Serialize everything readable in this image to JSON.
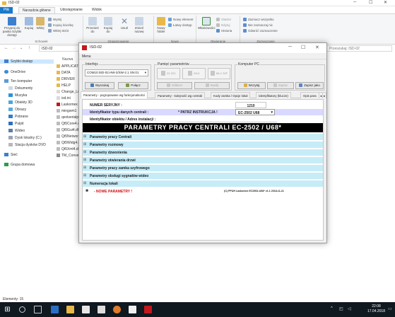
{
  "explorer": {
    "title": "ISD-02",
    "tabs": [
      "Plik",
      "Narzędzia główne",
      "Udostępnianie",
      "Widok"
    ],
    "ribbon": {
      "groups": [
        {
          "label": "Schowek",
          "buttons": [
            "Przypnij do paska Szybki dostęp",
            "Kopiuj",
            "Wklej"
          ],
          "small": [
            "Wytnij",
            "Kopiuj ścieżkę",
            "Wklej skrót"
          ]
        },
        {
          "label": "Organizowanie",
          "buttons": [
            "Przenieś do",
            "Kopiuj do",
            "Usuń",
            "Zmień nazwę"
          ]
        },
        {
          "label": "Nowy",
          "buttons": [
            "Nowy folder"
          ],
          "small": [
            "Nowy element",
            "Łatwy dostęp"
          ]
        },
        {
          "label": "Otwieranie",
          "buttons": [
            "Właściwości"
          ],
          "small": [
            "Otwórz",
            "Edytuj",
            "Historia"
          ]
        },
        {
          "label": "Zaznaczanie",
          "small": [
            "Zaznacz wszystko",
            "Nie zaznaczaj nic",
            "Odwróć zaznaczenie"
          ]
        }
      ]
    },
    "address": "ISD-02",
    "search_placeholder": "Przeszukaj: ISD-02",
    "nav": [
      "Szybki dostęp",
      "OneDrive",
      "Ten komputer",
      "Dokumenty",
      "Muzyka",
      "Obiekty 3D",
      "Obrazy",
      "Pobrane",
      "Pulpit",
      "Wideo",
      "Dysk lokalny (C:)",
      "Stacja dysków DVD",
      "Sieć",
      "Grupa domowa"
    ],
    "file_header": "Nazwa",
    "files": [
      "APPLICATI",
      "DATA",
      "DRIVER",
      "HELP",
      "Change_Lo",
      "isd.ini",
      "Laskomex",
      "mingwm1",
      "qextserialp",
      "Qt5Core4.dll",
      "Qt5Gui4.dll",
      "Qt5Network",
      "Qt5Widg4.dll",
      "Qt5Xml4.dll",
      "TM_Conve"
    ],
    "status": "Elementy: 15",
    "clock_time": "22:08",
    "clock_date": "17.04.2018"
  },
  "app": {
    "title": "ISD-02",
    "menu": "Menu",
    "interfejs_label": "Interfejs",
    "port_value": "COM10:ISD-02.HW-2/SW-2.1 SN:01",
    "btn_wyszukaj": "Wyszukaj",
    "btn_polacz": "Połącz",
    "pamiec_label": "Pamięć parametrów",
    "mem_buttons": [
      "22.22C",
      "MLX",
      "MLX 32F"
    ],
    "btn_odbierz": "Odbierz",
    "btn_wyslij": "Wyślij",
    "komputer_label": "Komputer PC",
    "btn_wczytaj": "Wczytaj",
    "btn_zapisz": "Zapisz",
    "btn_zapisz_jako": "Zapisz jako",
    "tabs": [
      "Parametry - pogrupowane wg funkcjonalności",
      "Parametry - kolejność wg centrali",
      "Kody zamka / Opcje lokal",
      "Identyfikatory (klucze)",
      "Opis para"
    ],
    "rows": {
      "serial_label": "NUMER SERYJNY :",
      "serial_value": "1210",
      "type_label": "Identyfikator typu danych centrali :",
      "type_note": "* PATRZ INSTRUKCJA !",
      "type_value": "EC-2502 U68",
      "obj_label": "Identyfikator obiektu / Adres instalacji :",
      "banner": "PARAMETRY PRACY CENTRALI     EC-2502 / U68*",
      "groups": [
        "Parametry pracy Centrali",
        "Parametry rozmowy",
        "Parametry dzwonienia",
        "Parametry otwierania drzwi",
        "Parametry pracy zamka szyfrowego",
        "Parametry obsługi sygnałów wideo",
        "Numeracja lokali"
      ],
      "new_params": "- NOWE PARAMETRY !",
      "copyright": "(C) PPUH Laskomex  EC2502-U68*  v1.1   2018-11-21"
    }
  },
  "colors": {
    "accent": "#1979ca",
    "row_cyan": "#c6ecf8",
    "brand_red": "#c4181c"
  }
}
